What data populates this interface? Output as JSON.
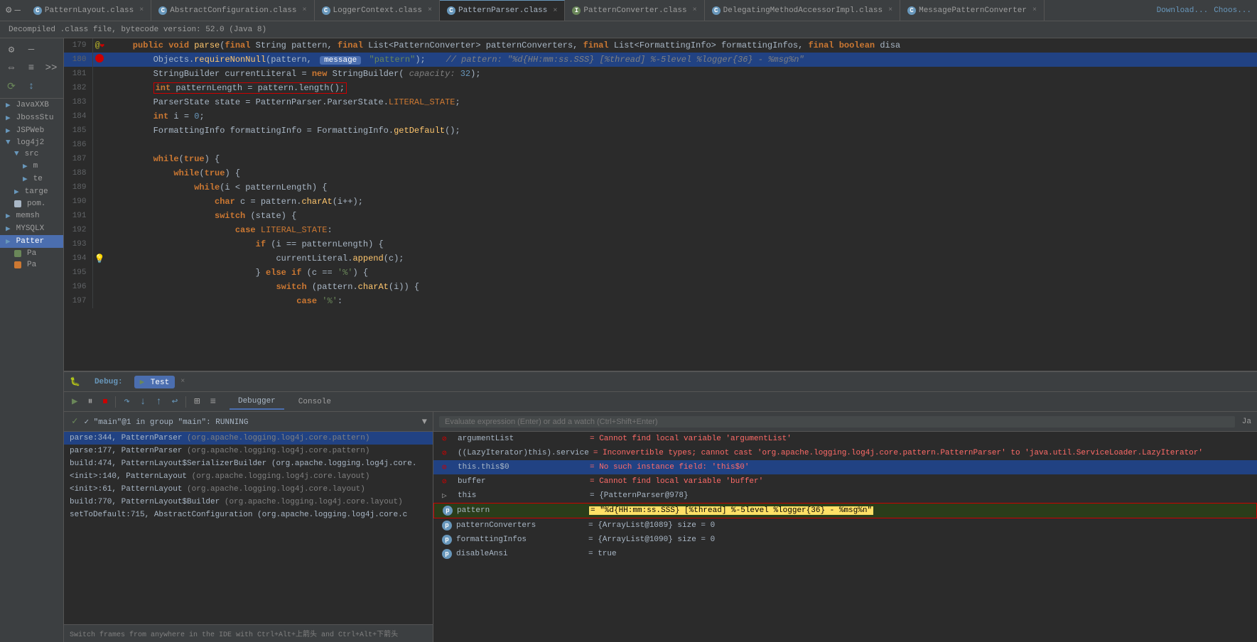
{
  "tabs": [
    {
      "label": "PatternLayout.class",
      "color": "#a9b7c6",
      "icon_color": "#6897bb",
      "active": false,
      "type": "c"
    },
    {
      "label": "AbstractConfiguration.class",
      "color": "#a9b7c6",
      "icon_color": "#6897bb",
      "active": false,
      "type": "c"
    },
    {
      "label": "LoggerContext.class",
      "color": "#a9b7c6",
      "icon_color": "#6897bb",
      "active": false,
      "type": "c"
    },
    {
      "label": "PatternParser.class",
      "color": "#a9b7c6",
      "icon_color": "#6897bb",
      "active": true,
      "type": "c"
    },
    {
      "label": "PatternConverter.class",
      "color": "#a9b7c6",
      "icon_color": "#6a8759",
      "active": false,
      "type": "i"
    },
    {
      "label": "DelegatingMethodAccessorImpl.class",
      "color": "#a9b7c6",
      "icon_color": "#6897bb",
      "active": false,
      "type": "c"
    },
    {
      "label": "MessagePatternConverter",
      "color": "#a9b7c6",
      "icon_color": "#6897bb",
      "active": false,
      "type": "c"
    }
  ],
  "info_bar": "Decompiled .class file, bytecode version: 52.0 (Java 8)",
  "download_label": "Download...",
  "choose_label": "Choos...",
  "sidebar": {
    "items": [
      {
        "label": "JavaXXB",
        "indent": 0,
        "type": "folder"
      },
      {
        "label": "JbossStu",
        "indent": 0,
        "type": "folder"
      },
      {
        "label": "JSPWeb",
        "indent": 0,
        "type": "folder"
      },
      {
        "label": "log4j2",
        "indent": 0,
        "type": "folder",
        "expanded": true
      },
      {
        "label": "src",
        "indent": 1,
        "type": "folder",
        "expanded": true
      },
      {
        "label": "m",
        "indent": 2,
        "type": "folder"
      },
      {
        "label": "te",
        "indent": 2,
        "type": "folder"
      },
      {
        "label": "targe",
        "indent": 1,
        "type": "folder"
      },
      {
        "label": "pom.",
        "indent": 1,
        "type": "file",
        "color": "#a9b7c6"
      },
      {
        "label": "memsh",
        "indent": 0,
        "type": "folder"
      },
      {
        "label": "MYSQLX",
        "indent": 0,
        "type": "folder"
      },
      {
        "label": "Patter",
        "indent": 0,
        "type": "folder",
        "selected": true,
        "color": "#4b6eaf"
      },
      {
        "label": "Pa",
        "indent": 1,
        "type": "file",
        "color": "#6a8759"
      },
      {
        "label": "Pa",
        "indent": 1,
        "type": "file",
        "color": "#cc7832"
      }
    ]
  },
  "code_lines": [
    {
      "num": 179,
      "gutter": "@",
      "content": "    public void parse(final String pattern, final List<PatternConverter> patternConverters, final List<FormattingInfo> formattingInfos, final boolean disa",
      "highlight": "blue_header",
      "annotation": true
    },
    {
      "num": 180,
      "gutter": "bp",
      "content": "        Objects.requireNonNull(pattern, \"message\", \"pattern\");    // pattern: \"%d{HH:mm:ss.SSS} [%thread] %-5level %logger{36} - %msg%n\"",
      "highlight": "blue"
    },
    {
      "num": 181,
      "gutter": "",
      "content": "        StringBuilder currentLiteral = new StringBuilder( capacity: 32);"
    },
    {
      "num": 182,
      "gutter": "",
      "content": "        int patternLength = pattern.length();",
      "highlight": "red_outline"
    },
    {
      "num": 183,
      "gutter": "",
      "content": "        ParserState state = PatternParser.ParserState.LITERAL_STATE;"
    },
    {
      "num": 184,
      "gutter": "",
      "content": "        int i = 0;"
    },
    {
      "num": 185,
      "gutter": "",
      "content": "        FormattingInfo formattingInfo = FormattingInfo.getDefault();"
    },
    {
      "num": 186,
      "gutter": "",
      "content": ""
    },
    {
      "num": 187,
      "gutter": "",
      "content": "        while(true) {"
    },
    {
      "num": 188,
      "gutter": "",
      "content": "            while(true) {"
    },
    {
      "num": 189,
      "gutter": "",
      "content": "                while(i < patternLength) {"
    },
    {
      "num": 190,
      "gutter": "",
      "content": "                    char c = pattern.charAt(i++);"
    },
    {
      "num": 191,
      "gutter": "",
      "content": "                    switch (state) {"
    },
    {
      "num": 192,
      "gutter": "",
      "content": "                        case LITERAL_STATE:"
    },
    {
      "num": 193,
      "gutter": "",
      "content": "                            if (i == patternLength) {"
    },
    {
      "num": 194,
      "gutter": "warn",
      "content": "                                currentLiteral.append(c);"
    },
    {
      "num": 195,
      "gutter": "",
      "content": "                            } else if (c == '%') {"
    },
    {
      "num": 196,
      "gutter": "",
      "content": "                                switch (pattern.charAt(i)) {"
    },
    {
      "num": 197,
      "gutter": "",
      "content": "                                    case '%':"
    }
  ],
  "debug_panel": {
    "tab_label": "Debug",
    "test_label": "Test",
    "tabs": [
      "Debugger",
      "Console"
    ],
    "active_tab": "Debugger",
    "toolbar_icons": [
      "resume",
      "pause",
      "stop",
      "step_over",
      "step_into",
      "step_out",
      "run_to_cursor",
      "frames",
      "threads"
    ],
    "thread_info": "✓ \"main\"@1 in group \"main\": RUNNING",
    "stack_frames": [
      {
        "text": "parse:344, PatternParser (org.apache.logging.log4j.core.pattern)",
        "selected": true
      },
      {
        "text": "parse:177, PatternParser (org.apache.logging.log4j.core.pattern)"
      },
      {
        "text": "build:474, PatternLayout$SerializerBuilder (org.apache.logging.log4j.core."
      },
      {
        "text": "<init>:140, PatternLayout (org.apache.logging.log4j.core.layout)"
      },
      {
        "text": "<init>:61, PatternLayout (org.apache.logging.log4j.core.layout)"
      },
      {
        "text": "build:770, PatternLayout$Builder (org.apache.logging.log4j.core.layout)"
      },
      {
        "text": "setToDefault:715, AbstractConfiguration (org.apache.logging.log4j.core.c"
      }
    ],
    "status_text": "Switch frames from anywhere in the IDE with Ctrl+Alt+上箭头 and Ctrl+Alt+下箭头",
    "watch_input_placeholder": "Evaluate expression (Enter) or add a watch (Ctrl+Shift+Enter)",
    "watches": [
      {
        "icon": "error",
        "name": "argumentList",
        "value": "= Cannot find local variable 'argumentList'",
        "type": "error"
      },
      {
        "icon": "error",
        "name": "((LazyIterator)this).service",
        "value": "= Inconvertible types; cannot cast 'org.apache.logging.log4j.core.pattern.PatternParser' to 'java.util.ServiceLoader.LazyIterator'",
        "type": "error"
      },
      {
        "icon": "error",
        "name": "this.this$0",
        "value": "= No such instance field: 'this$0'",
        "type": "error",
        "selected": true
      },
      {
        "icon": "error",
        "name": "buffer",
        "value": "= Cannot find local variable 'buffer'",
        "type": "error"
      },
      {
        "icon": "expand",
        "name": "this",
        "value": "= {PatternParser@978}",
        "type": "normal"
      },
      {
        "icon": "p",
        "name": "pattern",
        "value": "= \"%d{HH:mm:ss.SSS} [%thread] %-5level %logger{36} - %msg%n\"",
        "type": "highlight"
      },
      {
        "icon": "p",
        "name": "patternConverters",
        "value": "= {ArrayList@1089}  size = 0",
        "type": "normal"
      },
      {
        "icon": "p",
        "name": "formattingInfos",
        "value": "= {ArrayList@1090}  size = 0",
        "type": "normal"
      },
      {
        "icon": "p",
        "name": "disableAnsi",
        "value": "= true",
        "type": "normal"
      }
    ]
  },
  "left_toolbar": {
    "icons": [
      "⚙",
      "—",
      "⚙",
      "—",
      "⬅",
      "▶",
      "⏹",
      "↪",
      "↓",
      "↑",
      "↺",
      "⭐"
    ]
  }
}
